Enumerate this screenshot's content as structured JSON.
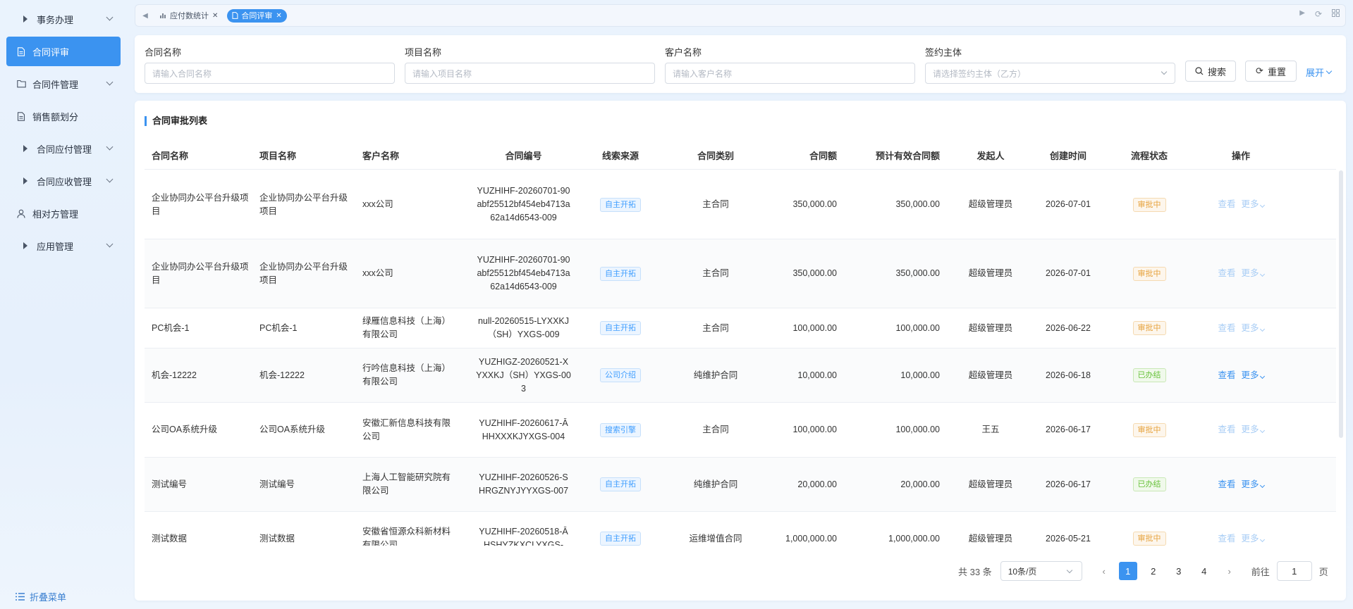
{
  "sidebar": {
    "items": [
      {
        "label": "事务办理",
        "icon": "triangle-right-icon",
        "has_children": true
      },
      {
        "label": "合同评审",
        "icon": "document-icon",
        "active": true
      },
      {
        "label": "合同件管理",
        "icon": "folder-icon",
        "has_children": true
      },
      {
        "label": "销售额划分",
        "icon": "document-icon"
      },
      {
        "label": "合同应付管理",
        "icon": "triangle-right-icon",
        "has_children": true
      },
      {
        "label": "合同应收管理",
        "icon": "triangle-right-icon",
        "has_children": true
      },
      {
        "label": "相对方管理",
        "icon": "user-icon"
      },
      {
        "label": "应用管理",
        "icon": "triangle-right-icon",
        "has_children": true
      }
    ],
    "collapse_label": "折叠菜单"
  },
  "tabs": [
    {
      "label": "应付数统计",
      "icon": "chart-icon"
    },
    {
      "label": "合同评审",
      "icon": "document-icon",
      "active": true
    }
  ],
  "filters": {
    "contract_name": {
      "label": "合同名称",
      "placeholder": "请输入合同名称"
    },
    "project_name": {
      "label": "项目名称",
      "placeholder": "请输入项目名称"
    },
    "customer_name": {
      "label": "客户名称",
      "placeholder": "请输入客户名称"
    },
    "signing_party": {
      "label": "签约主体",
      "placeholder": "请选择签约主体（乙方）"
    },
    "search_label": "搜索",
    "reset_label": "重置",
    "expand_label": "展开"
  },
  "table": {
    "title": "合同审批列表",
    "columns": [
      "合同名称",
      "项目名称",
      "客户名称",
      "合同编号",
      "线索来源",
      "合同类别",
      "合同额",
      "预计有效合同额",
      "发起人",
      "创建时间",
      "流程状态",
      "操作"
    ],
    "rows": [
      {
        "contract_name": "企业协同办公平台升级项目",
        "project_name": "企业协同办公平台升级项目",
        "customer": "xxx公司",
        "contract_no": "YUZHIHF-20260701-90abf25512bf454eb4713a62a14d6543-009",
        "source": "自主开拓",
        "category": "主合同",
        "amount": "350,000.00",
        "effective_amount": "350,000.00",
        "initiator": "超级管理员",
        "created": "2026-07-01",
        "status": "审批中",
        "status_type": "orange",
        "ops_disabled": true
      },
      {
        "contract_name": "企业协同办公平台升级项目",
        "project_name": "企业协同办公平台升级项目",
        "customer": "xxx公司",
        "contract_no": "YUZHIHF-20260701-90abf25512bf454eb4713a62a14d6543-009",
        "source": "自主开拓",
        "category": "主合同",
        "amount": "350,000.00",
        "effective_amount": "350,000.00",
        "initiator": "超级管理员",
        "created": "2026-07-01",
        "status": "审批中",
        "status_type": "orange",
        "ops_disabled": true
      },
      {
        "contract_name": "PC机会-1",
        "project_name": "PC机会-1",
        "customer": "绿雁信息科技（上海）有限公司",
        "contract_no": "null-20260515-LYXXKJ（SH）YXGS-009",
        "source": "自主开拓",
        "category": "主合同",
        "amount": "100,000.00",
        "effective_amount": "100,000.00",
        "initiator": "超级管理员",
        "created": "2026-06-22",
        "status": "审批中",
        "status_type": "orange",
        "ops_disabled": true
      },
      {
        "contract_name": "机会-12222",
        "project_name": "机会-12222",
        "customer": "行吟信息科技（上海）有限公司",
        "contract_no": "YUZHIGZ-20260521-XYXXKJ（SH）YXGS-003",
        "source": "公司介绍",
        "category": "纯维护合同",
        "amount": "10,000.00",
        "effective_amount": "10,000.00",
        "initiator": "超级管理员",
        "created": "2026-06-18",
        "status": "已办结",
        "status_type": "green",
        "ops_disabled": false
      },
      {
        "contract_name": "公司OA系统升级",
        "project_name": "公司OA系统升级",
        "customer": "安徽汇新信息科技有限公司",
        "contract_no": "YUZHIHF-20260617-ĀHHXXXKJYXGS-004",
        "source": "搜索引擎",
        "category": "主合同",
        "amount": "100,000.00",
        "effective_amount": "100,000.00",
        "initiator": "王五",
        "created": "2026-06-17",
        "status": "审批中",
        "status_type": "orange",
        "ops_disabled": true
      },
      {
        "contract_name": "测试编号",
        "project_name": "测试编号",
        "customer": "上海人工智能研究院有限公司",
        "contract_no": "YUZHIHF-20260526-SHRGZNYJYYXGS-007",
        "source": "自主开拓",
        "category": "纯维护合同",
        "amount": "20,000.00",
        "effective_amount": "20,000.00",
        "initiator": "超级管理员",
        "created": "2026-06-17",
        "status": "已办结",
        "status_type": "green",
        "ops_disabled": false
      },
      {
        "contract_name": "测试数据",
        "project_name": "测试数据",
        "customer": "安徽省恒源众科新材料有限公司",
        "contract_no": "YUZHIHF-20260518-ĀHSHYZKXCLYXGS-",
        "source": "自主开拓",
        "category": "运维增值合同",
        "amount": "1,000,000.00",
        "effective_amount": "1,000,000.00",
        "initiator": "超级管理员",
        "created": "2026-05-21",
        "status": "审批中",
        "status_type": "orange",
        "ops_disabled": true
      }
    ],
    "view_label": "查看",
    "more_label": "更多"
  },
  "pagination": {
    "total_label": "共 33 条",
    "page_size": "10条/页",
    "pages": [
      "1",
      "2",
      "3",
      "4"
    ],
    "current_page": "1",
    "prev_label": "‹",
    "next_label": "›",
    "goto_label": "前往",
    "goto_value": "1",
    "page_suffix": "页"
  },
  "colors": {
    "accent": "#3b93f0",
    "orange": "#e6a23c",
    "green": "#67c23a"
  }
}
